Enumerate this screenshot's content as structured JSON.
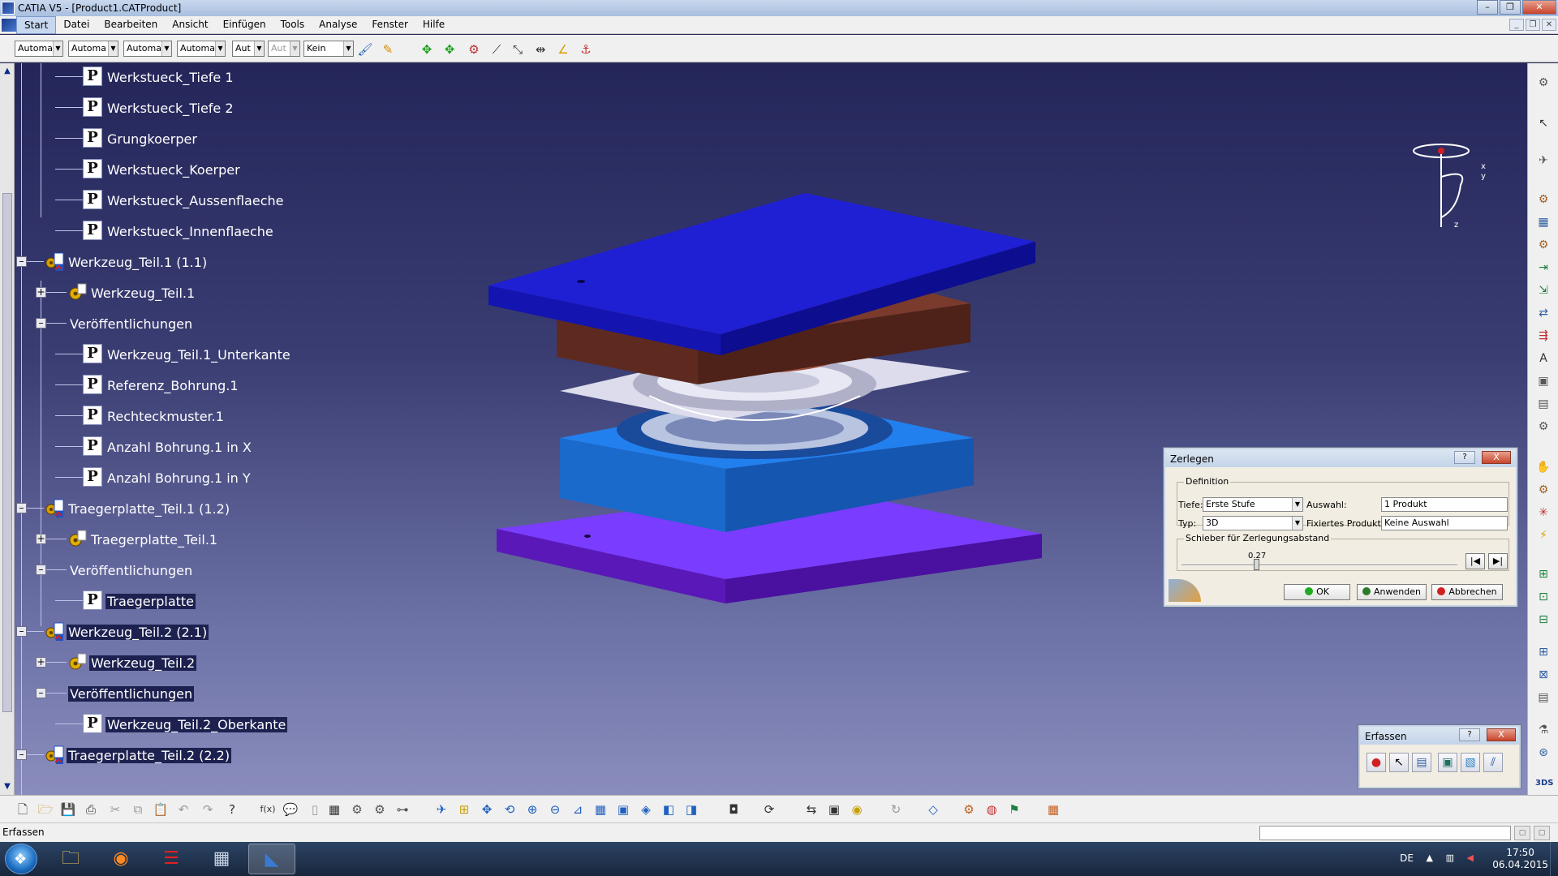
{
  "window": {
    "title": "CATIA V5 - [Product1.CATProduct]"
  },
  "menu": [
    "Start",
    "Datei",
    "Bearbeiten",
    "Ansicht",
    "Einfügen",
    "Tools",
    "Analyse",
    "Fenster",
    "Hilfe"
  ],
  "toolbar_combos": [
    "Automa",
    "Automa",
    "Automa",
    "Automa",
    "Aut",
    "Aut",
    "Kein"
  ],
  "tree": {
    "items": [
      {
        "label": "Werkstueck_Tiefe 1",
        "icon": "publication-icon"
      },
      {
        "label": "Werkstueck_Tiefe 2",
        "icon": "publication-icon"
      },
      {
        "label": "Grungkoerper",
        "icon": "publication-icon"
      },
      {
        "label": "Werkstueck_Koerper",
        "icon": "publication-icon"
      },
      {
        "label": "Werkstueck_Aussenflaeche",
        "icon": "publication-icon"
      },
      {
        "label": "Werkstueck_Innenflaeche",
        "icon": "publication-icon"
      },
      {
        "label": "Werkzeug_Teil.1 (1.1)",
        "icon": "product-icon"
      },
      {
        "label": "Werkzeug_Teil.1",
        "icon": "part-icon"
      },
      {
        "label": "Veröffentlichungen",
        "icon": "none"
      },
      {
        "label": "Werkzeug_Teil.1_Unterkante",
        "icon": "publication-icon"
      },
      {
        "label": "Referenz_Bohrung.1",
        "icon": "publication-icon"
      },
      {
        "label": "Rechteckmuster.1",
        "icon": "publication-icon"
      },
      {
        "label": "Anzahl Bohrung.1 in X",
        "icon": "publication-icon"
      },
      {
        "label": "Anzahl Bohrung.1 in Y",
        "icon": "publication-icon"
      },
      {
        "label": "Traegerplatte_Teil.1 (1.2)",
        "icon": "product-icon"
      },
      {
        "label": "Traegerplatte_Teil.1",
        "icon": "part-icon"
      },
      {
        "label": "Veröffentlichungen",
        "icon": "none"
      },
      {
        "label": "Traegerplatte",
        "icon": "publication-icon"
      },
      {
        "label": "Werkzeug_Teil.2 (2.1)",
        "icon": "product-icon"
      },
      {
        "label": "Werkzeug_Teil.2",
        "icon": "part-icon"
      },
      {
        "label": "Veröffentlichungen",
        "icon": "none"
      },
      {
        "label": "Werkzeug_Teil.2_Oberkante",
        "icon": "publication-icon"
      },
      {
        "label": "Traegerplatte_Teil.2 (2.2)",
        "icon": "product-icon"
      }
    ]
  },
  "compass_axes": {
    "x": "x",
    "y": "y",
    "z": "z"
  },
  "dialog_zerlegen": {
    "title": "Zerlegen",
    "help": "?",
    "close": "X",
    "definition_legend": "Definition",
    "tiefe_label": "Tiefe:",
    "tiefe_value": "Erste Stufe",
    "auswahl_label": "Auswahl:",
    "auswahl_value": "1 Produkt",
    "typ_label": "Typ:",
    "typ_value": "3D",
    "fixiertes_label": "Fixiertes Produkt:",
    "fixiertes_value": "Keine Auswahl",
    "slider_legend": "Schieber für Zerlegungsabstand",
    "slider_value": "0.27",
    "slider_fraction": 0.27,
    "ok": "OK",
    "anwenden": "Anwenden",
    "abbrechen": "Abbrechen"
  },
  "dialog_erfassen": {
    "title": "Erfassen",
    "help": "?",
    "close": "X"
  },
  "status": {
    "text": "Erfassen"
  },
  "taskbar": {
    "lang": "DE",
    "time": "17:50",
    "date": "06.04.2015"
  },
  "colors": {
    "plate_top": "#1a1ad8",
    "plate_brown": "#6b2f25",
    "plate_cyan": "#1f6fd8",
    "plate_violet": "#6a1ee0",
    "sheet": "#d0d0e0"
  }
}
